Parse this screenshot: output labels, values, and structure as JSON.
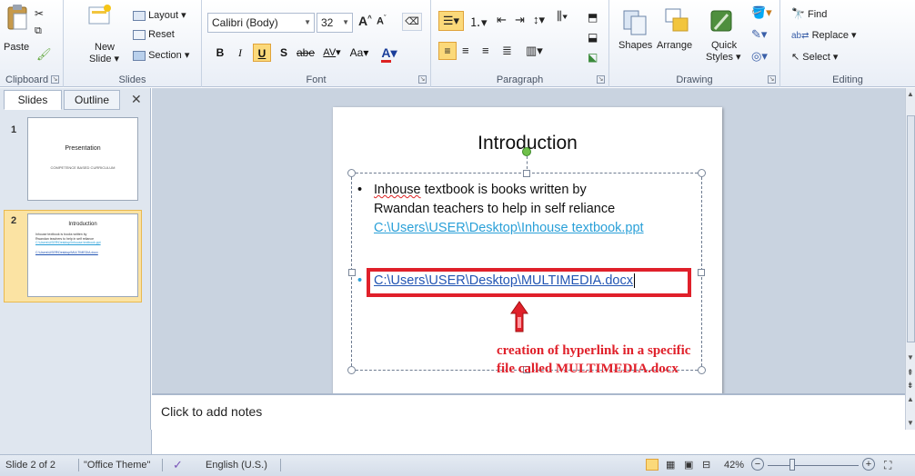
{
  "ribbon": {
    "clipboard": {
      "label": "Clipboard",
      "paste": "Paste"
    },
    "slides": {
      "label": "Slides",
      "new_slide": "New",
      "new_slide_2": "Slide",
      "layout": "Layout",
      "reset": "Reset",
      "section": "Section"
    },
    "font": {
      "label": "Font",
      "family": "Calibri (Body)",
      "size": "32",
      "bold": "B",
      "italic": "I",
      "underline": "U",
      "shadow": "S",
      "strike": "abe",
      "spacing": "AV",
      "case": "Aa",
      "color": "A"
    },
    "paragraph": {
      "label": "Paragraph"
    },
    "drawing": {
      "label": "Drawing",
      "shapes": "Shapes",
      "arrange": "Arrange",
      "quick": "Quick",
      "styles": "Styles"
    },
    "editing": {
      "label": "Editing",
      "find": "Find",
      "replace": "Replace",
      "select": "Select"
    }
  },
  "pane": {
    "tab_slides": "Slides",
    "tab_outline": "Outline",
    "slide1": {
      "num": "1",
      "title": "Presentation",
      "subtitle": "COMPETENCE BASED CURRICULUM"
    },
    "slide2": {
      "num": "2",
      "title": "Introduction",
      "lines": [
        "Inhouse textbook is books written by",
        "Rwandan teachers to help in self reliance",
        "C:\\Users\\USER\\Desktop\\Inhouse textbook.ppt",
        "C:\\Users\\USER\\Desktop\\MULTIMEDIA.docx"
      ]
    }
  },
  "slide": {
    "title": "Introduction",
    "bullet1_a": "Inhouse",
    "bullet1_b": " textbook is books written by",
    "bullet1_line2": "Rwandan teachers to help in self reliance",
    "link1": "C:\\Users\\USER\\Desktop\\Inhouse textbook.ppt",
    "link2": "C:\\Users\\USER\\Desktop\\MULTIMEDIA.docx",
    "annotation_line1": "creation of hyperlink in a specific",
    "annotation_line2": "file called MULTIMEDIA.docx"
  },
  "notes": {
    "placeholder": "Click to add notes"
  },
  "status": {
    "slide_count": "Slide 2 of 2",
    "theme": "\"Office Theme\"",
    "language": "English (U.S.)",
    "zoom": "42%"
  },
  "colors": {
    "annotation": "#e0202a",
    "link": "#2aa0d8",
    "link_visited": "#2255b3"
  }
}
